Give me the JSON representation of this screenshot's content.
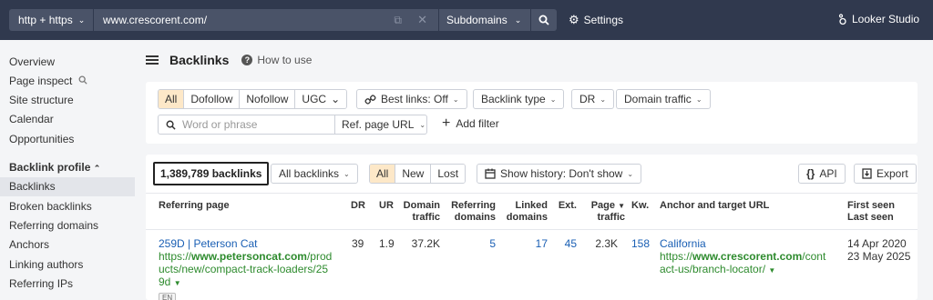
{
  "topbar": {
    "protocol": "http + https",
    "url_value": "www.crescorent.com/",
    "mode": "Subdomains",
    "settings_label": "Settings",
    "looker_label": "Looker Studio"
  },
  "sidebar": {
    "items_top": [
      "Overview",
      "Page inspect",
      "Site structure",
      "Calendar",
      "Opportunities"
    ],
    "section_label": "Backlink profile",
    "items_section": [
      "Backlinks",
      "Broken backlinks",
      "Referring domains",
      "Anchors",
      "Linking authors",
      "Referring IPs"
    ],
    "active": "Backlinks"
  },
  "header": {
    "title": "Backlinks",
    "how_to_use": "How to use"
  },
  "filters": {
    "type_tabs": [
      "All",
      "Dofollow",
      "Nofollow",
      "UGC"
    ],
    "best_links": "Best links: Off",
    "backlink_type": "Backlink type",
    "dr": "DR",
    "domain_traffic": "Domain traffic",
    "search_placeholder": "Word or phrase",
    "ref_page_url": "Ref. page URL",
    "add_filter": "Add filter"
  },
  "results": {
    "count": "1,389,789 backlinks",
    "scope": "All backlinks",
    "status_tabs": [
      "All",
      "New",
      "Lost"
    ],
    "history": "Show history: Don't show",
    "api": "API",
    "export": "Export",
    "columns": {
      "referring_page": "Referring page",
      "dr": "DR",
      "ur": "UR",
      "domain_traffic": [
        "Domain",
        "traffic"
      ],
      "referring_domains": [
        "Referring",
        "domains"
      ],
      "linked_domains": [
        "Linked",
        "domains"
      ],
      "ext": "Ext.",
      "page_traffic": [
        "Page",
        "traffic"
      ],
      "kw": "Kw.",
      "anchor": "Anchor and target URL",
      "first_seen": "First seen",
      "last_seen": "Last seen"
    },
    "rows": [
      {
        "title": "259D | Peterson Cat",
        "url_pre": "https://",
        "url_domain": "www.petersoncat.com",
        "url_lines": [
          "/prod",
          "ucts/new/compact-track-loaders/25",
          "9d"
        ],
        "lang": "EN",
        "dr": "39",
        "ur": "1.9",
        "domain_traffic": "37.2K",
        "referring_domains": "5",
        "linked_domains": "17",
        "ext": "45",
        "page_traffic": "2.3K",
        "kw": "158",
        "anchor": "California",
        "target_pre": "https://",
        "target_domain": "www.crescorent.com",
        "target_lines": [
          "/cont",
          "act-us/branch-locator/"
        ],
        "first_seen": "14 Apr 2020",
        "last_seen": "23 May 2025"
      }
    ]
  }
}
